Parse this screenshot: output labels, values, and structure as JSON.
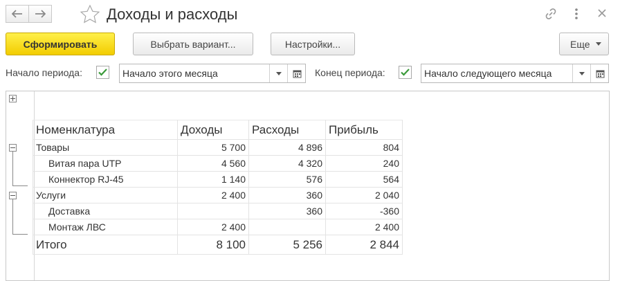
{
  "window": {
    "title": "Доходы и расходы"
  },
  "toolbar": {
    "generate_label": "Сформировать",
    "variant_label": "Выбрать вариант...",
    "settings_label": "Настройки...",
    "more_label": "Еще"
  },
  "period": {
    "start_label": "Начало периода:",
    "start_value": "Начало этого месяца",
    "end_label": "Конец периода:",
    "end_value": "Начало следующего месяца"
  },
  "table": {
    "headers": [
      "Номенклатура",
      "Доходы",
      "Расходы",
      "Прибыль"
    ],
    "rows": [
      {
        "name": "Товары",
        "income": "5 700",
        "expense": "4 896",
        "profit": "804"
      },
      {
        "name": "Витая пара UTP",
        "income": "4 560",
        "expense": "4 320",
        "profit": "240"
      },
      {
        "name": "Коннектор RJ-45",
        "income": "1 140",
        "expense": "576",
        "profit": "564"
      },
      {
        "name": "Услуги",
        "income": "2 400",
        "expense": "360",
        "profit": "2 040"
      },
      {
        "name": "Доставка",
        "income": "",
        "expense": "360",
        "profit": "-360"
      },
      {
        "name": "Монтаж ЛВС",
        "income": "2 400",
        "expense": "",
        "profit": "2 400"
      }
    ],
    "total": {
      "name": "Итого",
      "income": "8 100",
      "expense": "5 256",
      "profit": "2 844"
    }
  },
  "icons": {
    "back": "arrow-left-icon",
    "forward": "arrow-right-icon",
    "favorite": "star-icon",
    "link": "link-icon",
    "menu": "vertical-dots-icon",
    "close": "close-icon",
    "calendar": "calendar-icon",
    "dropdown": "chevron-down-icon"
  },
  "colors": {
    "primary_button": "#f5d20a",
    "checkbox_check": "#3a9a3a"
  }
}
